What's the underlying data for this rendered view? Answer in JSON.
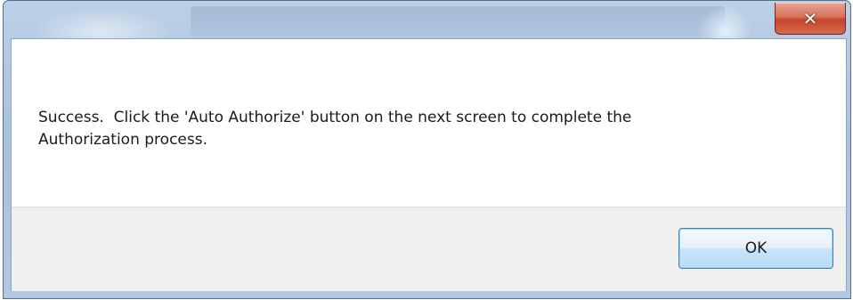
{
  "dialog": {
    "title": "",
    "message": "Success.  Click the 'Auto Authorize' button on the next screen to complete the\nAuthorization process.",
    "ok_label": "OK",
    "close_glyph": "✕"
  },
  "icons": {
    "close": "close-icon"
  },
  "colors": {
    "close_button": "#c7452c",
    "ok_button_border": "#3c7fb1",
    "button_panel": "#f0f0f0"
  }
}
